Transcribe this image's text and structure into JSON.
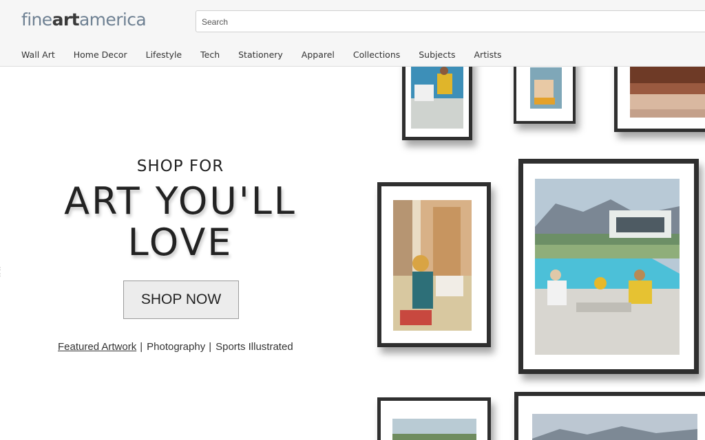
{
  "header": {
    "logo": {
      "part1": "fine",
      "part2": "art",
      "part3": "america"
    },
    "search": {
      "placeholder": "Search"
    },
    "nav": [
      "Wall Art",
      "Home Decor",
      "Lifestyle",
      "Tech",
      "Stationery",
      "Apparel",
      "Collections",
      "Subjects",
      "Artists"
    ]
  },
  "hero": {
    "pre_title": "SHOP FOR",
    "title_line1": "ART YOU'LL",
    "title_line2": "LOVE",
    "button_label": "SHOP NOW",
    "links": [
      {
        "label": "Featured Artwork",
        "sep": "|"
      },
      {
        "label": "Photography",
        "sep": "|"
      },
      {
        "label": "Sports Illustrated",
        "sep": ""
      }
    ]
  },
  "colors": {
    "frame": "#2f2f2f",
    "header_bg": "#f6f6f6",
    "logo_accent": "#6f8193",
    "text": "#222222"
  }
}
